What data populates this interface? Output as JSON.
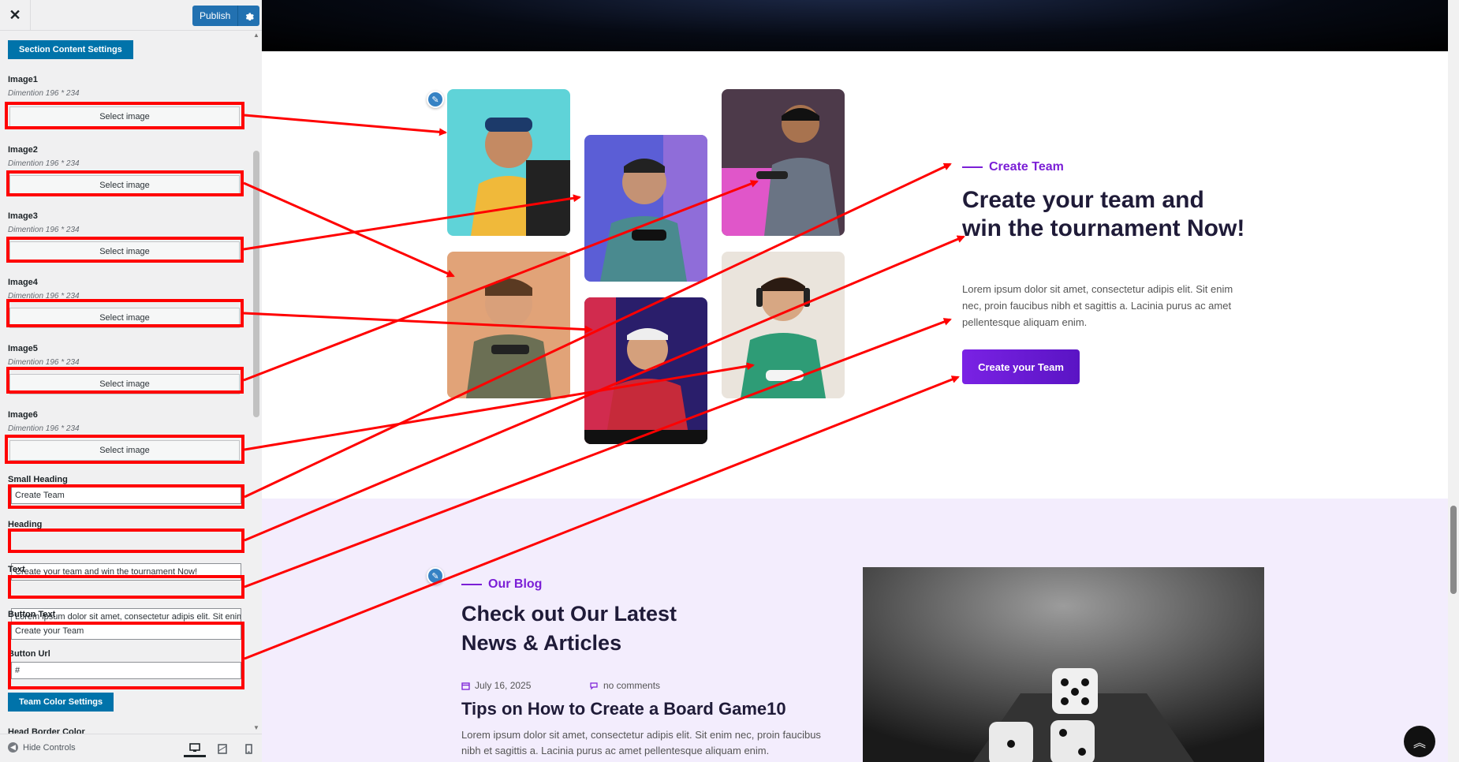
{
  "topbar": {
    "close_label": "✕",
    "publish_label": "Publish",
    "gear_icon": "gear-icon"
  },
  "sidebar": {
    "section_button": "Section Content Settings",
    "images": [
      {
        "label": "Image1",
        "desc": "Dimention 196 * 234",
        "button": "Select image"
      },
      {
        "label": "Image2",
        "desc": "Dimention 196 * 234",
        "button": "Select image"
      },
      {
        "label": "Image3",
        "desc": "Dimention 196 * 234",
        "button": "Select image"
      },
      {
        "label": "Image4",
        "desc": "Dimention 196 * 234",
        "button": "Select image"
      },
      {
        "label": "Image5",
        "desc": "Dimention 196 * 234",
        "button": "Select image"
      },
      {
        "label": "Image6",
        "desc": "Dimention 196 * 234",
        "button": "Select image"
      }
    ],
    "small_heading": {
      "label": "Small Heading",
      "value": "Create Team"
    },
    "heading": {
      "label": "Heading",
      "value": "Create your team and win the tournament Now!"
    },
    "text": {
      "label": "Text",
      "value": "Lorem ipsum dolor sit amet, consectetur adipis elit. Sit enim nec"
    },
    "button_text": {
      "label": "Button Text",
      "value": "Create your Team"
    },
    "button_url": {
      "label": "Button Url",
      "value": "#"
    },
    "color_button": "Team Color Settings",
    "cut_label": "Head Border Color",
    "hide_controls": "Hide Controls"
  },
  "team": {
    "small_heading": "Create Team",
    "heading": "Create your team and win the tournament Now!",
    "text": "Lorem ipsum dolor sit amet, consectetur adipis elit. Sit enim nec, proin faucibus nibh et sagittis a. Lacinia purus ac amet pellentesque aliquam enim.",
    "button": "Create your Team"
  },
  "blog": {
    "small_heading": "Our Blog",
    "heading": "Check out Our Latest News & Articles",
    "date": "July 16, 2025",
    "comments": "no comments",
    "post_title": "Tips on How to Create a Board Game10",
    "post_text": "Lorem ipsum dolor sit amet, consectetur adipis elit. Sit enim nec, proin faucibus nibh et sagittis a. Lacinia purus ac amet pellentesque aliquam enim."
  },
  "colors": {
    "accent": "#7b1fd6",
    "wp_blue": "#2271b1",
    "annotation": "#ff0000",
    "blog_bg": "#f3edfd"
  }
}
